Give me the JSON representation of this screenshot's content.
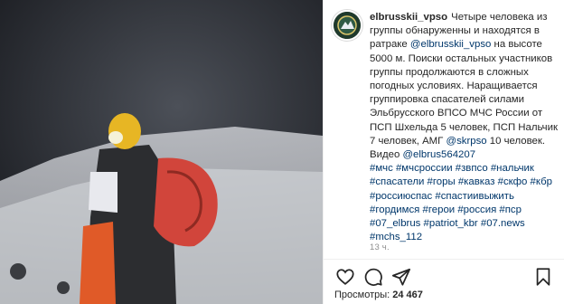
{
  "post": {
    "username": "elbrusskii_vpso",
    "caption_parts": [
      {
        "t": "Четыре человека из группы обнаруженны и находятся в ратраке ",
        "link": false
      },
      {
        "t": "@elbrusskii_vpso",
        "link": true
      },
      {
        "t": " на высоте 5000 м. Поиски остальных участников группы продолжаются в сложных погодных условиях. Наращивается группировка спасателей силами Эльбрусского ВПСО МЧС России от ПСП Шхельда 5 человек, ПСП Нальчик 7 человек, АМГ ",
        "link": false
      },
      {
        "t": "@skrpso",
        "link": true
      },
      {
        "t": " 10 человек. Видео ",
        "link": false
      },
      {
        "t": "@elbrus564207",
        "link": true
      }
    ],
    "hashtags": [
      "#мчс",
      "#мчсроссии",
      "#звпсо",
      "#нальчик",
      "#спасатели",
      "#горы",
      "#кавказ",
      "#скфо",
      "#кбр",
      "#россиюспас",
      "#спастиивыжить",
      "#гордимся",
      "#герои",
      "#россия",
      "#пср",
      "#07_elbrus",
      "#patriot_kbr",
      "#07.news",
      "#mchs_112"
    ],
    "time_ago": "13 ч.",
    "views_label": "Просмотры:",
    "views_count": "24 467"
  },
  "icons": {
    "like": "heart-icon",
    "comment": "comment-icon",
    "share": "share-icon",
    "save": "bookmark-icon"
  },
  "colors": {
    "link": "#00376b",
    "text": "#262626",
    "muted": "#8e8e8e"
  }
}
